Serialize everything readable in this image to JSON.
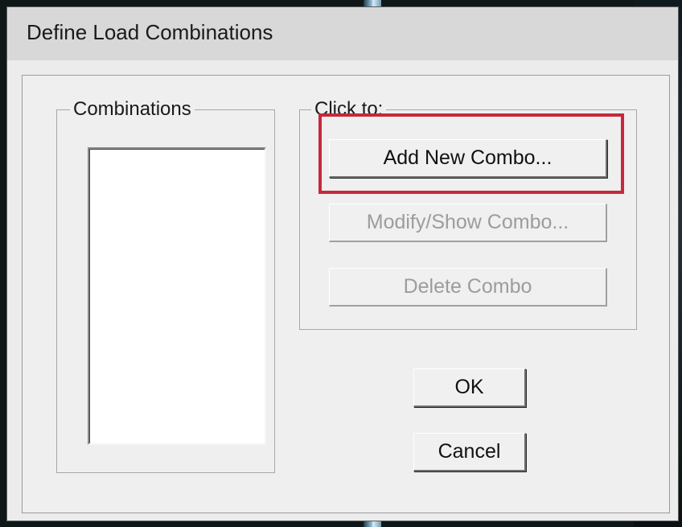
{
  "window": {
    "title": "Define Load Combinations"
  },
  "combinations_group": {
    "label": "Combinations",
    "items": []
  },
  "actions_group": {
    "label": "Click to:",
    "add_label": "Add New Combo...",
    "modify_label": "Modify/Show Combo...",
    "delete_label": "Delete Combo"
  },
  "footer": {
    "ok_label": "OK",
    "cancel_label": "Cancel"
  },
  "colors": {
    "highlight": "#c8283a",
    "dialog_bg": "#efefef"
  }
}
